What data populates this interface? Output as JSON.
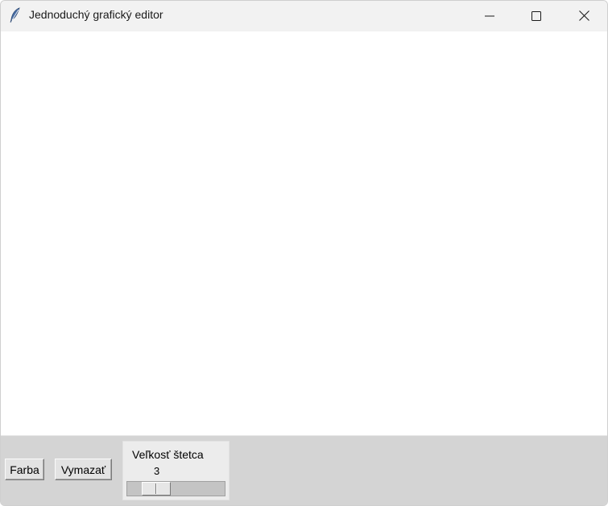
{
  "window": {
    "title": "Jednoduchý grafický editor",
    "icon": "feather-icon"
  },
  "window_controls": {
    "minimize_icon": "minimize-icon",
    "maximize_icon": "maximize-icon",
    "close_icon": "close-icon"
  },
  "toolbar": {
    "color_label": "Farba",
    "clear_label": "Vymazať"
  },
  "brush_scale": {
    "label": "Veľkosť štetca",
    "value": "3",
    "min": 1,
    "max": 10,
    "current": 3
  },
  "colors": {
    "canvas_bg": "#ffffff",
    "toolbar_bg": "#d4d4d4",
    "titlebar_bg": "#f2f2f2"
  }
}
